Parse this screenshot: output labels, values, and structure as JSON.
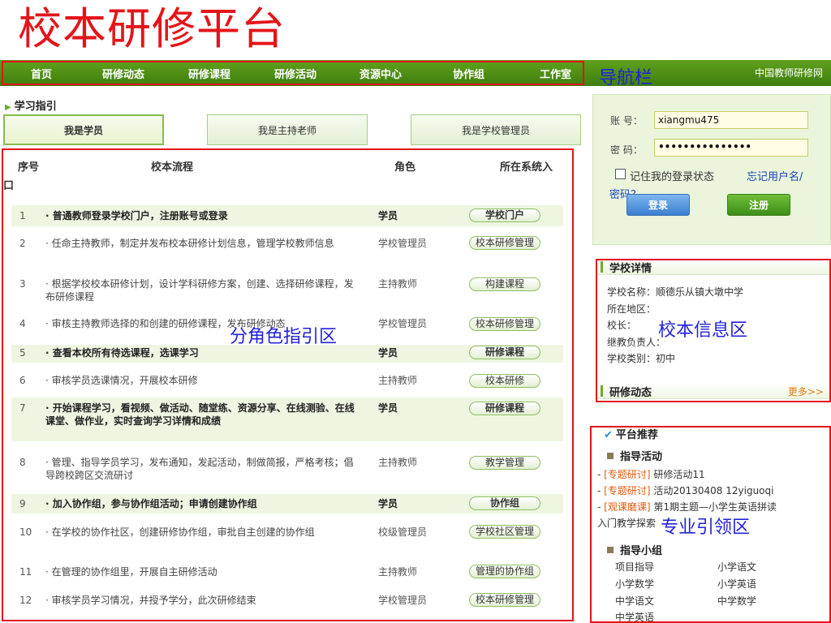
{
  "page_title": "校本研修平台",
  "nav": {
    "items": [
      "首页",
      "研修动态",
      "研修课程",
      "研修活动",
      "资源中心",
      "协作组",
      "工作室"
    ],
    "right_label": "中国教师研修网"
  },
  "annotations": {
    "nav": "导航栏",
    "guide": "分角色指引区",
    "school": "校本信息区",
    "leading": "专业引领区"
  },
  "guide": {
    "title": "学习指引",
    "tabs": [
      "我是学员",
      "我是主持老师",
      "我是学校管理员"
    ],
    "headers": {
      "num": "序号",
      "process": "校本流程",
      "role": "角色",
      "entry_a": "所在系统入",
      "entry_b": "口"
    },
    "rows": [
      {
        "num": "1",
        "desc": "· 普通教师登录学校门户，注册账号或登录",
        "role": "学员",
        "entry": "学校门户"
      },
      {
        "num": "2",
        "desc": "· 任命主持教师，制定并发布校本研修计划信息，管理学校教师信息",
        "role": "学校管理员",
        "entry": "校本研修管理"
      },
      {
        "num": "3",
        "desc": "· 根据学校校本研修计划，设计学科研修方案，创建、选择研修课程，发布研修课程",
        "role": "主持教师",
        "entry": "构建课程"
      },
      {
        "num": "4",
        "desc": "· 审核主持教师选择的和创建的研修课程，发布研修动态",
        "role": "学校管理员",
        "entry": "校本研修管理"
      },
      {
        "num": "5",
        "desc": "· 查看本校所有待选课程，选课学习",
        "role": "学员",
        "entry": "研修课程"
      },
      {
        "num": "6",
        "desc": "· 审核学员选课情况，开展校本研修",
        "role": "主持教师",
        "entry": "校本研修"
      },
      {
        "num": "7",
        "desc": "· 开始课程学习，看视频、做活动、随堂练、资源分享、在线测验、在线课堂、做作业，实时查询学习详情和成绩",
        "role": "学员",
        "entry": "研修课程"
      },
      {
        "num": "8",
        "desc": "· 管理、指导学员学习，发布通知，发起活动，制做简报，严格考核；倡导跨校跨区交流研讨",
        "role": "主持教师",
        "entry": "教学管理"
      },
      {
        "num": "9",
        "desc": "· 加入协作组，参与协作组活动；申请创建协作组",
        "role": "学员",
        "entry": "协作组"
      },
      {
        "num": "10",
        "desc": "· 在学校的协作社区，创建研修协作组，审批自主创建的协作组",
        "role": "校级管理员",
        "entry": "学校社区管理"
      },
      {
        "num": "11",
        "desc": "· 在管理的协作组里，开展自主研修活动",
        "role": "主持教师",
        "entry": "管理的协作组"
      },
      {
        "num": "12",
        "desc": "· 审核学员学习情况，并授予学分，此次研修结束",
        "role": "学校管理员",
        "entry": "校本研修管理"
      }
    ]
  },
  "login": {
    "account_label": "账 号：",
    "account_value": "xiangmu475",
    "password_label": "密 码：",
    "password_value": "•••••••••••••••",
    "remember": "记住我的登录状态",
    "forgot_a": "忘记用户名/",
    "forgot_b": "密码？",
    "login_button": "登录",
    "register_button": "注册"
  },
  "school": {
    "title": "学校详情",
    "lines": [
      "学校名称：顺德乐从镇大墩中学",
      "所在地区：",
      "校长：",
      "继教负责人：",
      "学校类别：初中"
    ]
  },
  "dynamics": {
    "title": "研修动态",
    "more": "更多>>"
  },
  "recommend": {
    "title": "平台推荐",
    "activities_title": "指导活动",
    "activities": [
      {
        "tag": "[专题研讨]",
        "text": "研修活动11"
      },
      {
        "tag": "[专题研讨]",
        "text": "活动20130408 12yiguoqi"
      },
      {
        "tag": "[观课磨课]",
        "text": "第1期主题—小学生英语拼读"
      }
    ],
    "activity_wrap": "入门教学探索",
    "groups_title": "指导小组",
    "groups": [
      "项目指导",
      "小学语文",
      "小学数学",
      "小学英语",
      "中学语文",
      "中学数学",
      "中学英语"
    ]
  }
}
